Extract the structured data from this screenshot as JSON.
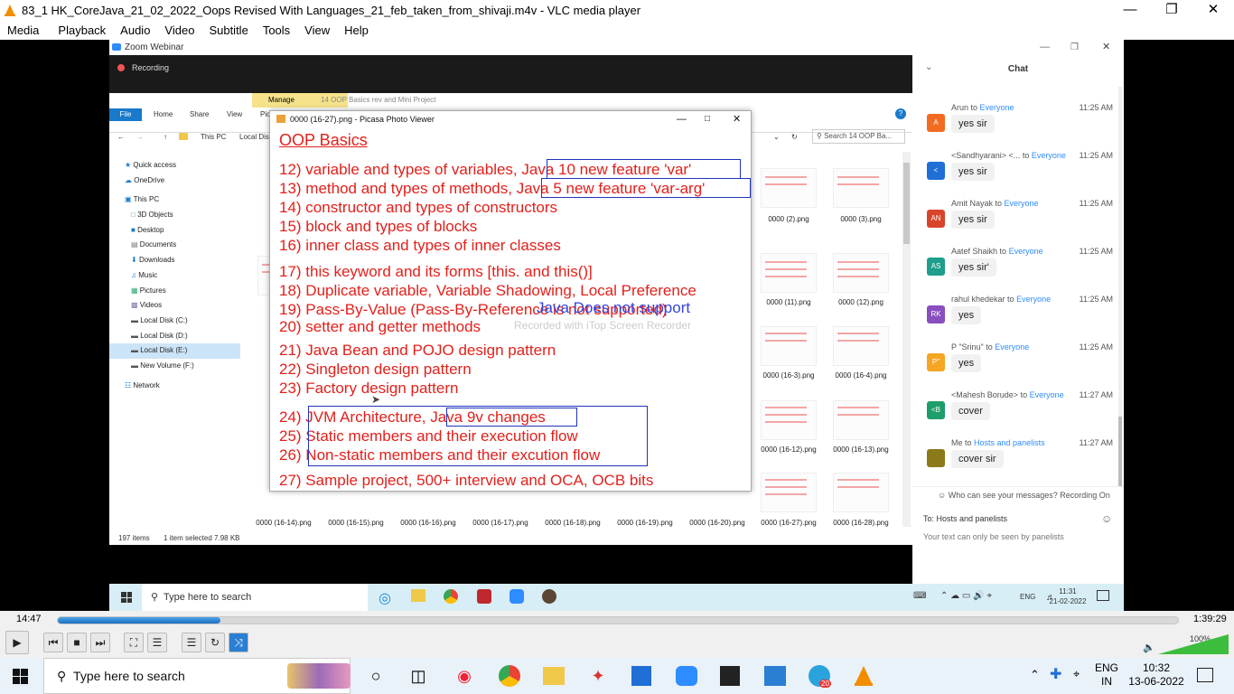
{
  "vlc": {
    "title": "83_1 HK_CoreJava_21_02_2022_Oops Revised With Languages_21_feb_taken_from_shivaji.m4v - VLC media player",
    "menu": [
      "Media",
      "Playback",
      "Audio",
      "Video",
      "Subtitle",
      "Tools",
      "View",
      "Help"
    ],
    "elapsed": "14:47",
    "total": "1:39:29",
    "progress": 0.145,
    "volume": "100%"
  },
  "zoom": {
    "title": "Zoom Webinar",
    "recording": "Recording"
  },
  "explorer": {
    "manage_tab": "Manage",
    "folder_title": "14 OOP Basics rev and Mini Project",
    "tabs": [
      "File",
      "Home",
      "Share",
      "View",
      "Pic"
    ],
    "address": [
      "This PC",
      "Local Dis"
    ],
    "search_placeholder": "Search 14 OOP Ba...",
    "sidebar": [
      "Quick access",
      "OneDrive",
      "This PC",
      "3D Objects",
      "Desktop",
      "Documents",
      "Downloads",
      "Music",
      "Pictures",
      "Videos",
      "Local Disk (C:)",
      "Local Disk (D:)",
      "Local Disk (E:)",
      "New Volume (F:)",
      "Network"
    ],
    "thumb_labels": [
      "0000 (2).png",
      "0000 (3).png",
      "0000 (11).png",
      "0000 (12).png",
      "0000 (16-3).png",
      "0000 (16-4).png",
      "0000 (16-12).png",
      "0000 (16-13).png",
      "0000 (16-14).png",
      "0000 (16-15).png",
      "0000 (16-16).png",
      "0000 (16-17).png",
      "0000 (16-18).png",
      "0000 (16-19).png",
      "0000 (16-20).png",
      "0000 (16-27).png",
      "0000 (16-28).png"
    ],
    "status_items": "197 items",
    "status_selected": "1 item selected  7.98 KB"
  },
  "picasa": {
    "title": "0000 (16-27).png - Picasa Photo Viewer",
    "heading": "OOP Basics",
    "lines": [
      "12) variable and types of variables, Java 10 new feature 'var'",
      "13) method and types of methods, Java 5 new feature 'var-arg'",
      "14) constructor and types of constructors",
      "15) block and types of blocks",
      "16) inner class and types of inner classes",
      "17) this keyword and its forms [this. and this()]",
      "18) Duplicate variable, Variable Shadowing, Local Preference",
      "19) Pass-By-Value  (Pass-By-Reference is not supported)",
      "20) setter and getter methods",
      "21) Java Bean and POJO design pattern",
      "22) Singleton design pattern",
      "23) Factory design pattern",
      "24) JVM Architecture, Java 9v changes",
      "25) Static members and their execution flow",
      "26) Non-static members and their excution flow",
      "27) Sample project, 500+ interview and OCA, OCB bits"
    ],
    "overlay_blue": "Java Does not support",
    "watermark": "Recorded with iTop Screen Recorder"
  },
  "chat": {
    "title": "Chat",
    "messages": [
      {
        "from": "Arun",
        "to": "Everyone",
        "time": "11:25 AM",
        "text": "yes sir",
        "initials": "A",
        "color": "#f26b21"
      },
      {
        "from": "<Sandhyarani> <...",
        "to": "Everyone",
        "time": "11:25 AM",
        "text": "yes sir",
        "initials": "<",
        "color": "#1f6fd6"
      },
      {
        "from": "Amit Nayak",
        "to": "Everyone",
        "time": "11:25 AM",
        "text": "yes sir",
        "initials": "AN",
        "color": "#d9452b"
      },
      {
        "from": "Aatef Shaikh",
        "to": "Everyone",
        "time": "11:25 AM",
        "text": "yes sir'",
        "initials": "AS",
        "color": "#1e9e8b"
      },
      {
        "from": "rahul khedekar",
        "to": "Everyone",
        "time": "11:25 AM",
        "text": "yes",
        "initials": "RK",
        "color": "#8a4fbf"
      },
      {
        "from": "P \"Srinu\"",
        "to": "Everyone",
        "time": "11:25 AM",
        "text": "yes",
        "initials": "P\"",
        "color": "#f5a623"
      },
      {
        "from": "<Mahesh Borude>",
        "to": "Everyone",
        "time": "11:27 AM",
        "text": "cover",
        "initials": "<B",
        "color": "#1e9e6a"
      },
      {
        "from": "Me",
        "to": "Hosts and panelists",
        "time": "11:27 AM",
        "text": "cover sir",
        "initials": "",
        "color": "#8a7a1a"
      }
    ],
    "privacy": "Who can see your messages? Recording On",
    "to_label": "To:  Hosts and panelists",
    "input_placeholder": "Your text can only be seen by panelists"
  },
  "inner_taskbar": {
    "search": "Type here to search",
    "lang": "ENG",
    "time": "11:31",
    "date": "21-02-2022"
  },
  "taskbar": {
    "search": "Type here to search",
    "lang1": "ENG",
    "lang2": "IN",
    "time": "10:32",
    "date": "13-06-2022",
    "badge": "20"
  }
}
